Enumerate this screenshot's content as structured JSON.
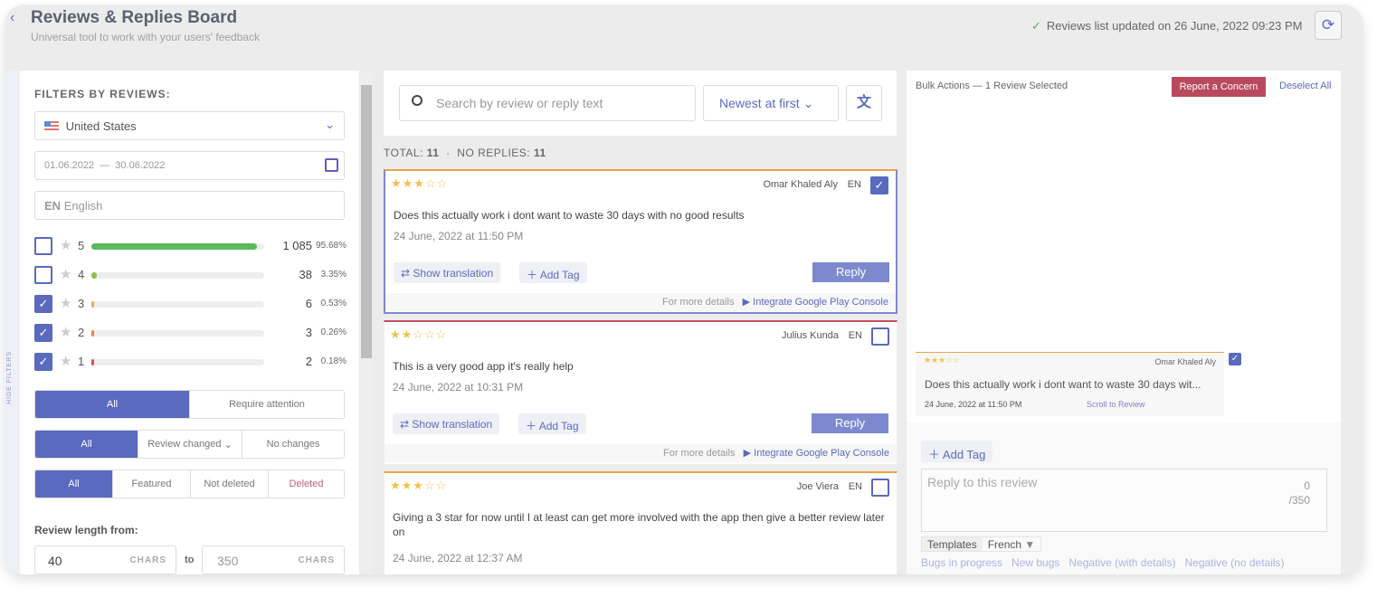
{
  "header": {
    "title": "Reviews & Replies Board",
    "subtitle": "Universal tool to work with your users' feedback",
    "status": "Reviews list updated on 26 June, 2022 09:23 PM"
  },
  "filters": {
    "heading": "FILTERS BY REVIEWS:",
    "country": "United States",
    "date_from": "01.06.2022",
    "date_to": "30.06.2022",
    "lang_code": "EN",
    "lang_name": "English",
    "hide_label": "HIDE FILTERS",
    "ratings": [
      {
        "stars": "5",
        "count": "1 085",
        "pct": "95.68%",
        "fill": 95.68,
        "checked": false,
        "color": "#5cb85c"
      },
      {
        "stars": "4",
        "count": "38",
        "pct": "3.35%",
        "fill": 3.35,
        "checked": false,
        "color": "#8bc34a"
      },
      {
        "stars": "3",
        "count": "6",
        "pct": "0.53%",
        "fill": 0.53,
        "checked": true,
        "color": "#f0ad4e"
      },
      {
        "stars": "2",
        "count": "3",
        "pct": "0.26%",
        "fill": 0.26,
        "checked": true,
        "color": "#f0804e"
      },
      {
        "stars": "1",
        "count": "2",
        "pct": "0.18%",
        "fill": 0.18,
        "checked": true,
        "color": "#d9534f"
      }
    ],
    "attention": [
      "All",
      "Require attention"
    ],
    "changes": [
      "All",
      "Review changed",
      "No changes"
    ],
    "deleted": [
      "All",
      "Featured",
      "Not deleted",
      "Deleted"
    ],
    "length_label": "Review length from:",
    "length_from": "40",
    "length_to": "350",
    "chars": "CHARS",
    "to": "to"
  },
  "list": {
    "search_placeholder": "Search by review or reply text",
    "sort": "Newest at first",
    "total_label": "TOTAL:",
    "total": "11",
    "noreply_label": "NO REPLIES:",
    "noreply": "11",
    "show_translation": "Show translation",
    "add_tag": "Add Tag",
    "reply": "Reply",
    "more_details": "For more details",
    "integrate": "Integrate Google Play Console",
    "reviews": [
      {
        "rating": 3,
        "author": "Omar Khaled Aly",
        "lang": "EN",
        "text": "Does this actually work i dont want to waste 30 days with no good results",
        "date": "24 June, 2022 at 11:50 PM",
        "checked": true
      },
      {
        "rating": 2,
        "author": "Julius Kunda",
        "lang": "EN",
        "text": "This is a very good app it's really help",
        "date": "24 June, 2022 at 10:31 PM",
        "checked": false
      },
      {
        "rating": 3,
        "author": "Joe Viera",
        "lang": "EN",
        "text": "Giving a 3 star for now until I at least can get more involved with the app then give a better review later on",
        "date": "24 June, 2022 at 12:37 AM",
        "checked": false
      }
    ]
  },
  "panel": {
    "bulk": "Bulk Actions — 1 Review Selected",
    "report": "Report a Concern",
    "deselect": "Deselect All",
    "selected": {
      "author": "Omar Khaled Aly",
      "text": "Does this actually work i dont want to waste 30 days wit...",
      "date": "24 June, 2022 at 11:50 PM",
      "scroll": "Scroll to Review"
    },
    "add_tag": "Add Tag",
    "reply_placeholder": "Reply to this review",
    "count": "0",
    "max": "/350",
    "templates": "Templates",
    "template_lang": "French",
    "template_items": [
      "Bugs in progress",
      "New bugs",
      "Negative (with details)",
      "Negative (no details)"
    ]
  }
}
